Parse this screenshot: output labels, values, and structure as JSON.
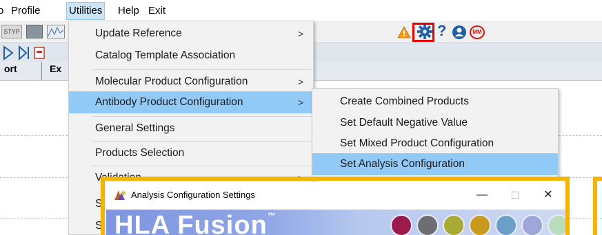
{
  "menubar": {
    "items": [
      {
        "label": "o"
      },
      {
        "label": "Profile"
      },
      {
        "label": "Utilities"
      },
      {
        "label": "Help"
      },
      {
        "label": "Exit"
      }
    ]
  },
  "toolbar": {
    "stype_label": "STYP",
    "icons": [
      "warning-icon",
      "gear-icon",
      "help-icon",
      "user-icon",
      "mm-icon"
    ],
    "mm_text": "MM",
    "help_text": "?"
  },
  "table": {
    "headers": [
      "ort",
      "Ex"
    ]
  },
  "utilities_menu": {
    "items": [
      {
        "label": "Update Reference",
        "submenu": true
      },
      {
        "label": "Catalog Template Association",
        "submenu": false
      },
      {
        "label": "Molecular Product Configuration",
        "submenu": true
      },
      {
        "label": "Antibody Product Configuration",
        "submenu": true
      },
      {
        "label": "General Settings",
        "submenu": false
      },
      {
        "label": "Products Selection",
        "submenu": false
      },
      {
        "label": "Validation",
        "submenu": true
      },
      {
        "label": "S",
        "submenu": false
      },
      {
        "label": "S",
        "submenu": false
      }
    ],
    "arrow": ">"
  },
  "antibody_submenu": {
    "items": [
      {
        "label": "Create Combined Products"
      },
      {
        "label": "Set Default Negative Value"
      },
      {
        "label": "Set Mixed Product Configuration"
      },
      {
        "label": "Set Analysis Configuration"
      }
    ]
  },
  "dialog": {
    "title": "Analysis Configuration Settings",
    "minimize": "—",
    "maximize": "☐",
    "close": "✕",
    "brand": "HLA Fusion",
    "trademark": "™",
    "dot_colors": [
      "#9b1b4f",
      "#6d6e71",
      "#a9a935",
      "#c99a1e",
      "#6b9fc7",
      "#9fa6d8",
      "#b9dcbc"
    ]
  },
  "colors": {
    "highlight": "#91c9f7",
    "menubar_active": "#cce4f7",
    "callout_red": "#e00000",
    "callout_gold": "#f5b400",
    "banner_blue": "#7e95e0"
  }
}
